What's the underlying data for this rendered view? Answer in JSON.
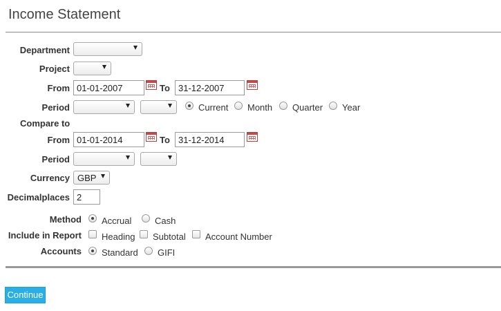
{
  "title": "Income Statement",
  "labels": {
    "department": "Department",
    "project": "Project",
    "from": "From",
    "to": "To",
    "period": "Period",
    "compare_to": "Compare to",
    "currency": "Currency",
    "decimalplaces": "Decimalplaces",
    "method": "Method",
    "include_in_report": "Include in Report",
    "accounts": "Accounts"
  },
  "period_options": {
    "current": "Current",
    "month": "Month",
    "quarter": "Quarter",
    "year": "Year",
    "selected": "Current"
  },
  "main_range": {
    "from": "01-01-2007",
    "to": "31-12-2007"
  },
  "compare_range": {
    "from": "01-01-2014",
    "to": "31-12-2014"
  },
  "currency_value": "GBP",
  "decimalplaces_value": "2",
  "method_options": {
    "accrual": "Accrual",
    "cash": "Cash",
    "selected": "Accrual"
  },
  "include_options": {
    "heading": "Heading",
    "subtotal": "Subtotal",
    "account_number": "Account Number"
  },
  "accounts_options": {
    "standard": "Standard",
    "gifi": "GIFI",
    "selected": "Standard"
  },
  "continue_label": "Continue",
  "icons": {
    "calendar": "calendar-icon",
    "dropdown": "chevron-down-icon"
  },
  "colors": {
    "button": "#2aaee6",
    "calendar": "#c84848"
  }
}
